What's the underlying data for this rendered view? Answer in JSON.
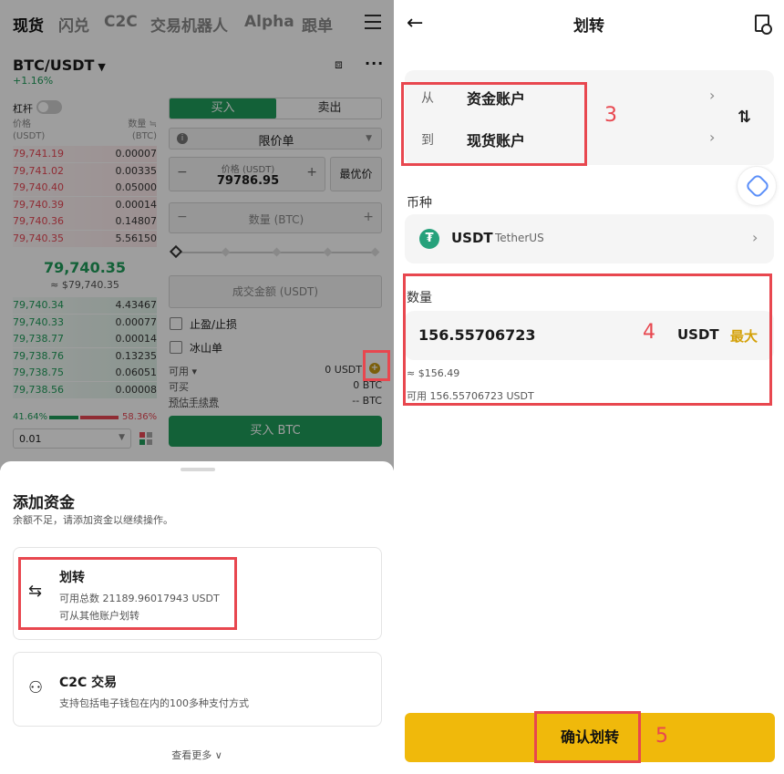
{
  "left": {
    "top_tabs": [
      "现货",
      "闪兑",
      "C2C",
      "交易机器人",
      "Alpha",
      "跟单"
    ],
    "pair": "BTC/USDT",
    "change": "+1.16%",
    "leverage_label": "杠杆",
    "orderbook": {
      "price_header": "价格",
      "price_unit": "(USDT)",
      "qty_header": "数量 ≒",
      "qty_unit": "(BTC)",
      "asks": [
        {
          "price": "79,741.19",
          "qty": "0.00007"
        },
        {
          "price": "79,741.02",
          "qty": "0.00335"
        },
        {
          "price": "79,740.40",
          "qty": "0.05000"
        },
        {
          "price": "79,740.39",
          "qty": "0.00014"
        },
        {
          "price": "79,740.36",
          "qty": "0.14807"
        },
        {
          "price": "79,740.35",
          "qty": "5.56150"
        }
      ],
      "mid_price": "79,740.35",
      "mid_usd": "≈ $79,740.35",
      "bids": [
        {
          "price": "79,740.34",
          "qty": "4.43467"
        },
        {
          "price": "79,740.33",
          "qty": "0.00077"
        },
        {
          "price": "79,738.77",
          "qty": "0.00014"
        },
        {
          "price": "79,738.76",
          "qty": "0.13235"
        },
        {
          "price": "79,738.75",
          "qty": "0.06051"
        },
        {
          "price": "79,738.56",
          "qty": "0.00008"
        }
      ],
      "buy_ratio": "41.64%",
      "sell_ratio": "58.36%",
      "precision": "0.01"
    },
    "trade": {
      "buy_tab": "买入",
      "sell_tab": "卖出",
      "order_type": "限价单",
      "price_label": "价格 (USDT)",
      "price_value": "79786.95",
      "best_price": "最优价",
      "qty_placeholder": "数量 (BTC)",
      "amount_placeholder": "成交金额 (USDT)",
      "tp_sl": "止盈/止损",
      "iceberg": "冰山单",
      "available_label": "可用",
      "available_value": "0 USDT",
      "can_buy_label": "可买",
      "can_buy_value": "0 BTC",
      "fee_label": "预估手续费",
      "fee_value": "-- BTC",
      "buy_button": "买入 BTC"
    },
    "sheet": {
      "title": "添加资金",
      "subtitle": "余额不足，请添加资金以继续操作。",
      "options": [
        {
          "title": "划转",
          "line1": "可用总数 21189.96017943 USDT",
          "line2": "可从其他账户划转"
        },
        {
          "title": "C2C 交易",
          "line1": "支持包括电子钱包在内的100多种支付方式",
          "line2": ""
        }
      ],
      "see_more": "查看更多 ∨"
    }
  },
  "right": {
    "title": "划转",
    "from_label": "从",
    "from_account": "资金账户",
    "to_label": "到",
    "to_account": "现货账户",
    "coin_label": "币种",
    "coin_symbol": "USDT",
    "coin_name": "TetherUS",
    "qty_label": "数量",
    "qty_value": "156.55706723",
    "qty_unit": "USDT",
    "qty_max": "最大",
    "qty_usd": "≈ $156.49",
    "qty_available": "可用 156.55706723 USDT",
    "confirm": "确认划转"
  },
  "annotations": {
    "tag3": "3",
    "tag4": "4",
    "tag5": "5",
    "accent": "#e8474f"
  },
  "icons": [
    "menu-icon",
    "chart-icon",
    "more-icon",
    "info-icon",
    "grid-icon",
    "transfer-icon",
    "c2c-icon",
    "back-icon",
    "record-icon",
    "chevron-right-icon",
    "swap-icon",
    "ai-assistant-icon",
    "tether-icon",
    "plus-coin-icon"
  ],
  "colors": {
    "buy": "#1f9d5b",
    "sell": "#e84855",
    "brand": "#f0b90b"
  }
}
